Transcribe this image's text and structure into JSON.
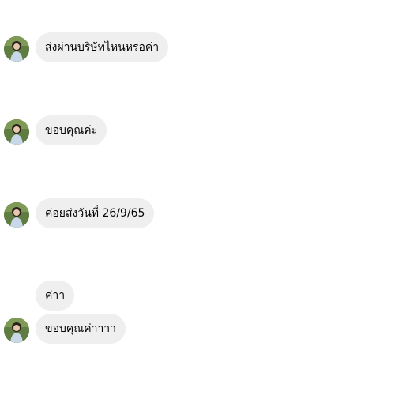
{
  "conversation": {
    "messages": [
      {
        "text": "ส่งผ่านบริษัทไหนหรอค่า"
      },
      {
        "text": "ขอบคุณค่ะ"
      },
      {
        "text": "ค่อยส่งวันที่ 26/9/65"
      },
      {
        "text": "ค่าา"
      },
      {
        "text": "ขอบคุณค่าาาา"
      }
    ]
  },
  "colors": {
    "bubble_background": "#efefef",
    "text": "#050505",
    "page_background": "#ffffff"
  },
  "icons": {
    "avatar": "user-avatar-photo"
  }
}
